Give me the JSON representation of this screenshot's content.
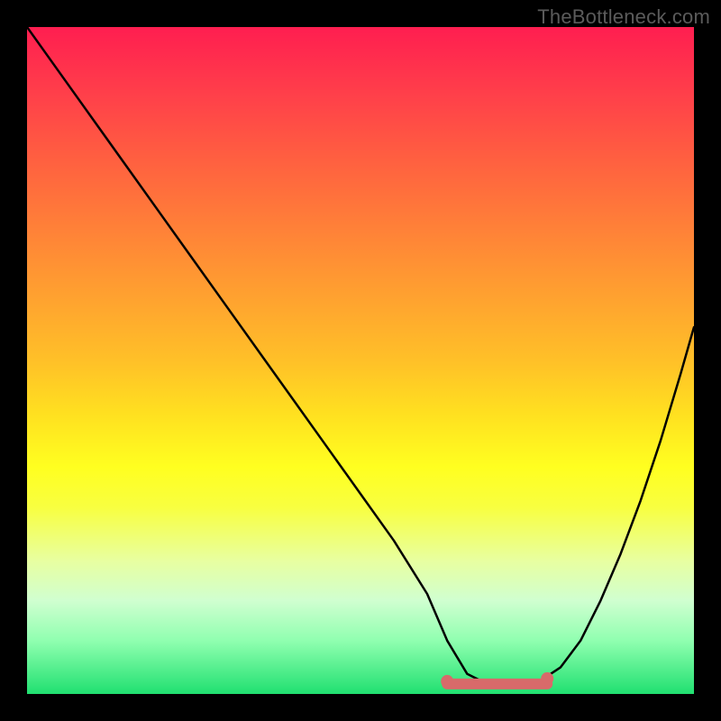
{
  "watermark": "TheBottleneck.com",
  "chart_data": {
    "type": "line",
    "title": "",
    "xlabel": "",
    "ylabel": "",
    "xlim": [
      0,
      100
    ],
    "ylim": [
      0,
      100
    ],
    "background_gradient": {
      "top": "#ff1e50",
      "mid": "#ffe020",
      "bottom": "#20e070"
    },
    "series": [
      {
        "name": "bottleneck-curve",
        "stroke": "#000000",
        "x": [
          0,
          5,
          10,
          15,
          20,
          25,
          30,
          35,
          40,
          45,
          50,
          55,
          60,
          63,
          66,
          70,
          74,
          77,
          80,
          83,
          86,
          89,
          92,
          95,
          98,
          100
        ],
        "y": [
          100,
          93,
          86,
          79,
          72,
          65,
          58,
          51,
          44,
          37,
          30,
          23,
          15,
          8,
          3,
          1,
          1,
          2,
          4,
          8,
          14,
          21,
          29,
          38,
          48,
          55
        ]
      },
      {
        "name": "optimal-range-marker",
        "stroke": "#e06060",
        "type": "segment",
        "x": [
          63,
          78
        ],
        "y": [
          1.5,
          1.5
        ],
        "endpoint_dots": true
      }
    ],
    "optimal_range_pct": [
      63,
      78
    ]
  }
}
